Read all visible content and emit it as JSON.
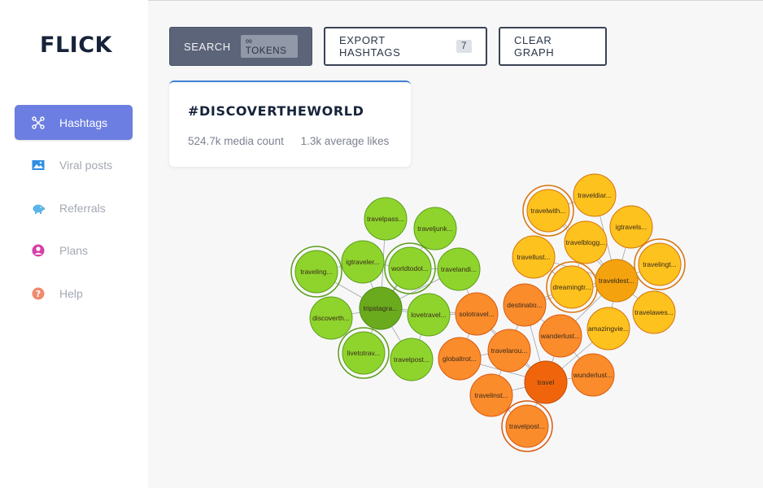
{
  "app": {
    "name": "FLICK"
  },
  "sidebar": {
    "items": [
      {
        "label": "Hashtags",
        "icon": "network-icon",
        "active": true,
        "color": "#ffffff"
      },
      {
        "label": "Viral posts",
        "icon": "image-icon",
        "active": false,
        "color": "#2e8fe3"
      },
      {
        "label": "Referrals",
        "icon": "piggy-bank-icon",
        "active": false,
        "color": "#5bb4e8"
      },
      {
        "label": "Plans",
        "icon": "user-circle-icon",
        "active": false,
        "color": "#d63fa8"
      },
      {
        "label": "Help",
        "icon": "question-circle-icon",
        "active": false,
        "color": "#ef8a6e"
      }
    ]
  },
  "toolbar": {
    "search_label": "SEARCH",
    "tokens_label": "∞ TOKENS",
    "export_label": "EXPORT HASHTAGS",
    "export_count": "7",
    "clear_label": "CLEAR GRAPH"
  },
  "hashtag_card": {
    "title": "#DISCOVERTHEWORLD",
    "media_count": "524.7k media count",
    "average_likes": "1.3k average likes"
  },
  "colors": {
    "accent": "#6c7ee1",
    "green_cluster": "#8fd42d",
    "green_hub": "#6aab1e",
    "orange_cluster": "#fb8c2c",
    "orange_hub": "#f0650c",
    "yellow_cluster": "#fdc21e",
    "yellow_hub": "#f4a30e"
  },
  "graph": {
    "nodes": [
      {
        "id": "travelpass",
        "label": "travelpass..."
      },
      {
        "id": "traveljunk",
        "label": "traveljunk..."
      },
      {
        "id": "traveling",
        "label": "traveling..."
      },
      {
        "id": "igtraveler",
        "label": "igtraveler..."
      },
      {
        "id": "worldtodo",
        "label": "worldtodol..."
      },
      {
        "id": "travelandi",
        "label": "travelandi..."
      },
      {
        "id": "discoverth",
        "label": "discoverth..."
      },
      {
        "id": "tripstagram",
        "label": "tripstagra..."
      },
      {
        "id": "lovetravel",
        "label": "lovetravel..."
      },
      {
        "id": "livetotrav",
        "label": "livetotrav..."
      },
      {
        "id": "travelpost_g",
        "label": "travelpost..."
      },
      {
        "id": "travelwith",
        "label": "travelwith..."
      },
      {
        "id": "traveldiar",
        "label": "traveldiar..."
      },
      {
        "id": "igtravels",
        "label": "igtravels..."
      },
      {
        "id": "travelblogg",
        "label": "travelblogg..."
      },
      {
        "id": "travellust",
        "label": "travellust..."
      },
      {
        "id": "travelingt",
        "label": "travelingt..."
      },
      {
        "id": "dreamingtr",
        "label": "dreamingtr..."
      },
      {
        "id": "traveldest",
        "label": "traveldest..."
      },
      {
        "id": "travelawes",
        "label": "travelawes..."
      },
      {
        "id": "amazingvie",
        "label": "amazingvie..."
      },
      {
        "id": "solotravel",
        "label": "solotravel..."
      },
      {
        "id": "destinatio",
        "label": "destinatio..."
      },
      {
        "id": "wanderlust1",
        "label": "wanderlust..."
      },
      {
        "id": "globaltrot",
        "label": "globaltrot..."
      },
      {
        "id": "travelarou",
        "label": "travelarou..."
      },
      {
        "id": "travel",
        "label": "travel"
      },
      {
        "id": "wunderlust",
        "label": "wunderlust..."
      },
      {
        "id": "travelinst",
        "label": "travelinst..."
      },
      {
        "id": "travelpost_o",
        "label": "travelpost..."
      }
    ]
  }
}
